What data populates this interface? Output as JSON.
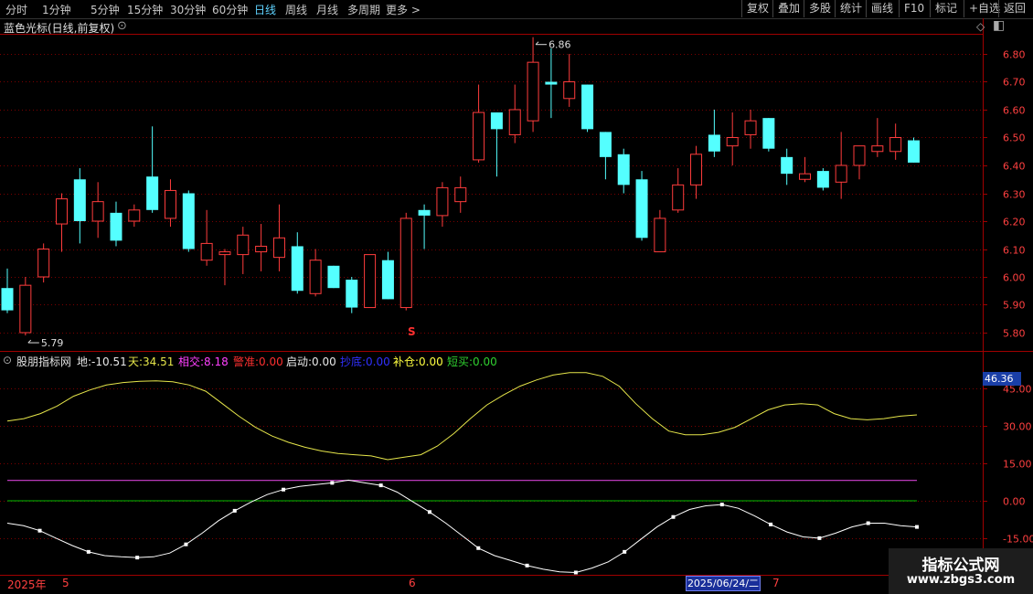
{
  "toolbar": {
    "periods": [
      "分时",
      "1分钟",
      "5分钟",
      "15分钟",
      "30分钟",
      "60分钟",
      "日线",
      "周线",
      "月线",
      "多周期",
      "更多 >"
    ],
    "active_period": "日线",
    "tools": [
      "复权",
      "叠加",
      "多股",
      "统计",
      "画线",
      "F10",
      "标记",
      "+自选",
      "返回"
    ]
  },
  "main_panel": {
    "title": "蓝色光标(日线,前复权)"
  },
  "indicator_panel": {
    "name": "股朋指标网",
    "items": [
      {
        "label": "地:",
        "value": "-10.51",
        "color": "#e8e8e8"
      },
      {
        "label": "天:",
        "value": "34.51",
        "color": "#e6e64a"
      },
      {
        "label": "相交:",
        "value": "8.18",
        "color": "#ff40ff"
      },
      {
        "label": "警准:",
        "value": "0.00",
        "color": "#ff3030"
      },
      {
        "label": "启动:",
        "value": "0.00",
        "color": "#e8e8e8"
      },
      {
        "label": "抄底:",
        "value": "0.00",
        "color": "#3030ff"
      },
      {
        "label": "补仓:",
        "value": "0.00",
        "color": "#ffff40"
      },
      {
        "label": "短买:",
        "value": "0.00",
        "color": "#30d030"
      }
    ],
    "current_value_tag": "46.36"
  },
  "colors": {
    "up": "#ff3c3c",
    "down": "#54ffff",
    "axis": "#a00000",
    "tian": "#e6e64a",
    "di": "#ffffff",
    "xiangjiao": "#d040d0",
    "zero": "#00c000"
  },
  "chart_data": [
    {
      "type": "candlestick",
      "ylim": [
        5.75,
        6.85
      ],
      "yticks": [
        "6.80",
        "6.70",
        "6.60",
        "6.50",
        "6.40",
        "6.30",
        "6.20",
        "6.10",
        "6.00",
        "5.90",
        "5.80"
      ],
      "annotations": [
        {
          "text": "5.79",
          "price": 5.79,
          "index": 1
        },
        {
          "text": "6.86",
          "price": 6.86,
          "index": 29
        }
      ],
      "candles": [
        {
          "o": 5.96,
          "h": 6.03,
          "l": 5.87,
          "c": 5.88
        },
        {
          "o": 5.8,
          "h": 6.0,
          "l": 5.79,
          "c": 5.97
        },
        {
          "o": 6.0,
          "h": 6.12,
          "l": 5.98,
          "c": 6.1
        },
        {
          "o": 6.19,
          "h": 6.3,
          "l": 6.09,
          "c": 6.28
        },
        {
          "o": 6.35,
          "h": 6.39,
          "l": 6.12,
          "c": 6.2
        },
        {
          "o": 6.2,
          "h": 6.34,
          "l": 6.14,
          "c": 6.27
        },
        {
          "o": 6.23,
          "h": 6.27,
          "l": 6.11,
          "c": 6.13
        },
        {
          "o": 6.2,
          "h": 6.26,
          "l": 6.18,
          "c": 6.24
        },
        {
          "o": 6.36,
          "h": 6.54,
          "l": 6.23,
          "c": 6.24
        },
        {
          "o": 6.21,
          "h": 6.35,
          "l": 6.18,
          "c": 6.31
        },
        {
          "o": 6.3,
          "h": 6.31,
          "l": 6.09,
          "c": 6.1
        },
        {
          "o": 6.06,
          "h": 6.24,
          "l": 6.04,
          "c": 6.12
        },
        {
          "o": 6.08,
          "h": 6.1,
          "l": 5.97,
          "c": 6.09
        },
        {
          "o": 6.08,
          "h": 6.18,
          "l": 6.01,
          "c": 6.15
        },
        {
          "o": 6.09,
          "h": 6.19,
          "l": 6.02,
          "c": 6.11
        },
        {
          "o": 6.07,
          "h": 6.26,
          "l": 6.02,
          "c": 6.14
        },
        {
          "o": 6.11,
          "h": 6.16,
          "l": 5.94,
          "c": 5.95
        },
        {
          "o": 5.94,
          "h": 6.1,
          "l": 5.93,
          "c": 6.06
        },
        {
          "o": 6.04,
          "h": 6.04,
          "l": 5.96,
          "c": 5.96
        },
        {
          "o": 5.99,
          "h": 6.0,
          "l": 5.87,
          "c": 5.89
        },
        {
          "o": 5.89,
          "h": 6.08,
          "l": 5.89,
          "c": 6.08
        },
        {
          "o": 6.06,
          "h": 6.09,
          "l": 5.92,
          "c": 5.92
        },
        {
          "o": 5.89,
          "h": 6.23,
          "l": 5.88,
          "c": 6.21
        },
        {
          "o": 6.24,
          "h": 6.26,
          "l": 6.1,
          "c": 6.22
        },
        {
          "o": 6.22,
          "h": 6.34,
          "l": 6.18,
          "c": 6.32
        },
        {
          "o": 6.27,
          "h": 6.36,
          "l": 6.23,
          "c": 6.32
        },
        {
          "o": 6.42,
          "h": 6.69,
          "l": 6.41,
          "c": 6.59
        },
        {
          "o": 6.59,
          "h": 6.59,
          "l": 6.36,
          "c": 6.53
        },
        {
          "o": 6.51,
          "h": 6.69,
          "l": 6.48,
          "c": 6.6
        },
        {
          "o": 6.56,
          "h": 6.86,
          "l": 6.52,
          "c": 6.77
        },
        {
          "o": 6.7,
          "h": 6.82,
          "l": 6.57,
          "c": 6.69
        },
        {
          "o": 6.64,
          "h": 6.8,
          "l": 6.61,
          "c": 6.7
        },
        {
          "o": 6.69,
          "h": 6.69,
          "l": 6.52,
          "c": 6.53
        },
        {
          "o": 6.52,
          "h": 6.52,
          "l": 6.35,
          "c": 6.43
        },
        {
          "o": 6.44,
          "h": 6.46,
          "l": 6.3,
          "c": 6.33
        },
        {
          "o": 6.35,
          "h": 6.38,
          "l": 6.13,
          "c": 6.14
        },
        {
          "o": 6.09,
          "h": 6.24,
          "l": 6.09,
          "c": 6.21
        },
        {
          "o": 6.24,
          "h": 6.39,
          "l": 6.23,
          "c": 6.33
        },
        {
          "o": 6.33,
          "h": 6.47,
          "l": 6.28,
          "c": 6.44
        },
        {
          "o": 6.51,
          "h": 6.6,
          "l": 6.43,
          "c": 6.45
        },
        {
          "o": 6.47,
          "h": 6.59,
          "l": 6.4,
          "c": 6.5
        },
        {
          "o": 6.51,
          "h": 6.6,
          "l": 6.46,
          "c": 6.56
        },
        {
          "o": 6.57,
          "h": 6.57,
          "l": 6.45,
          "c": 6.46
        },
        {
          "o": 6.43,
          "h": 6.46,
          "l": 6.33,
          "c": 6.37
        },
        {
          "o": 6.35,
          "h": 6.43,
          "l": 6.34,
          "c": 6.37
        },
        {
          "o": 6.38,
          "h": 6.39,
          "l": 6.31,
          "c": 6.32
        },
        {
          "o": 6.34,
          "h": 6.52,
          "l": 6.28,
          "c": 6.4
        },
        {
          "o": 6.4,
          "h": 6.47,
          "l": 6.35,
          "c": 6.47
        },
        {
          "o": 6.45,
          "h": 6.57,
          "l": 6.43,
          "c": 6.47
        },
        {
          "o": 6.45,
          "h": 6.55,
          "l": 6.42,
          "c": 6.5
        },
        {
          "o": 6.49,
          "h": 6.5,
          "l": 6.41,
          "c": 6.41
        }
      ]
    },
    {
      "type": "line",
      "ylim": [
        -24,
        52
      ],
      "yticks": [
        "45.00",
        "30.00",
        "15.00",
        "0.00",
        "-15.00"
      ],
      "series": [
        {
          "name": "天",
          "values": [
            32,
            33,
            35,
            38,
            42,
            44.5,
            46.5,
            47.5,
            48,
            48.2,
            47.8,
            46.5,
            44,
            39,
            34,
            29.5,
            26,
            23.5,
            21.5,
            20,
            19,
            18.5,
            18,
            16.5,
            17.5,
            18.5,
            22,
            27,
            33,
            38.5,
            42.5,
            46,
            48.5,
            50.5,
            51.5,
            51.5,
            50,
            46,
            39,
            33,
            28,
            26.5,
            26.5,
            27.5,
            29.5,
            33,
            36.5,
            38.5,
            39,
            38.5,
            35,
            33,
            32.5,
            33,
            34,
            34.5
          ]
        },
        {
          "name": "地",
          "values": [
            -9,
            -10,
            -12,
            -15,
            -18,
            -20.5,
            -22,
            -22.5,
            -22.8,
            -22.5,
            -21,
            -17.5,
            -13,
            -8,
            -4,
            -0.5,
            2.5,
            4.5,
            5.8,
            6.5,
            7.2,
            8.3,
            7.2,
            6.2,
            3.5,
            -0.5,
            -4.5,
            -9,
            -14,
            -19,
            -22,
            -24,
            -26,
            -27.5,
            -28.5,
            -28.8,
            -27,
            -24.5,
            -20.5,
            -15.5,
            -10.5,
            -6.5,
            -3.5,
            -2,
            -1.5,
            -3,
            -6,
            -9.5,
            -12.5,
            -14.5,
            -15,
            -13,
            -10.5,
            -9,
            -9,
            -10,
            -10.5
          ]
        },
        {
          "name": "相交",
          "values": [
            8.18
          ]
        },
        {
          "name": "zero",
          "values": [
            0
          ]
        }
      ]
    }
  ],
  "xaxis": {
    "labels": [
      {
        "text": "2025年",
        "index": 0
      },
      {
        "text": "5",
        "index": 3
      },
      {
        "text": "6",
        "index": 22
      },
      {
        "text": "7",
        "index": 42
      }
    ],
    "cursor_date": "2025/06/24/二",
    "signal_mark": "S"
  },
  "watermark": {
    "line1": "指标公式网",
    "line2": "www.zbgs3.com"
  }
}
